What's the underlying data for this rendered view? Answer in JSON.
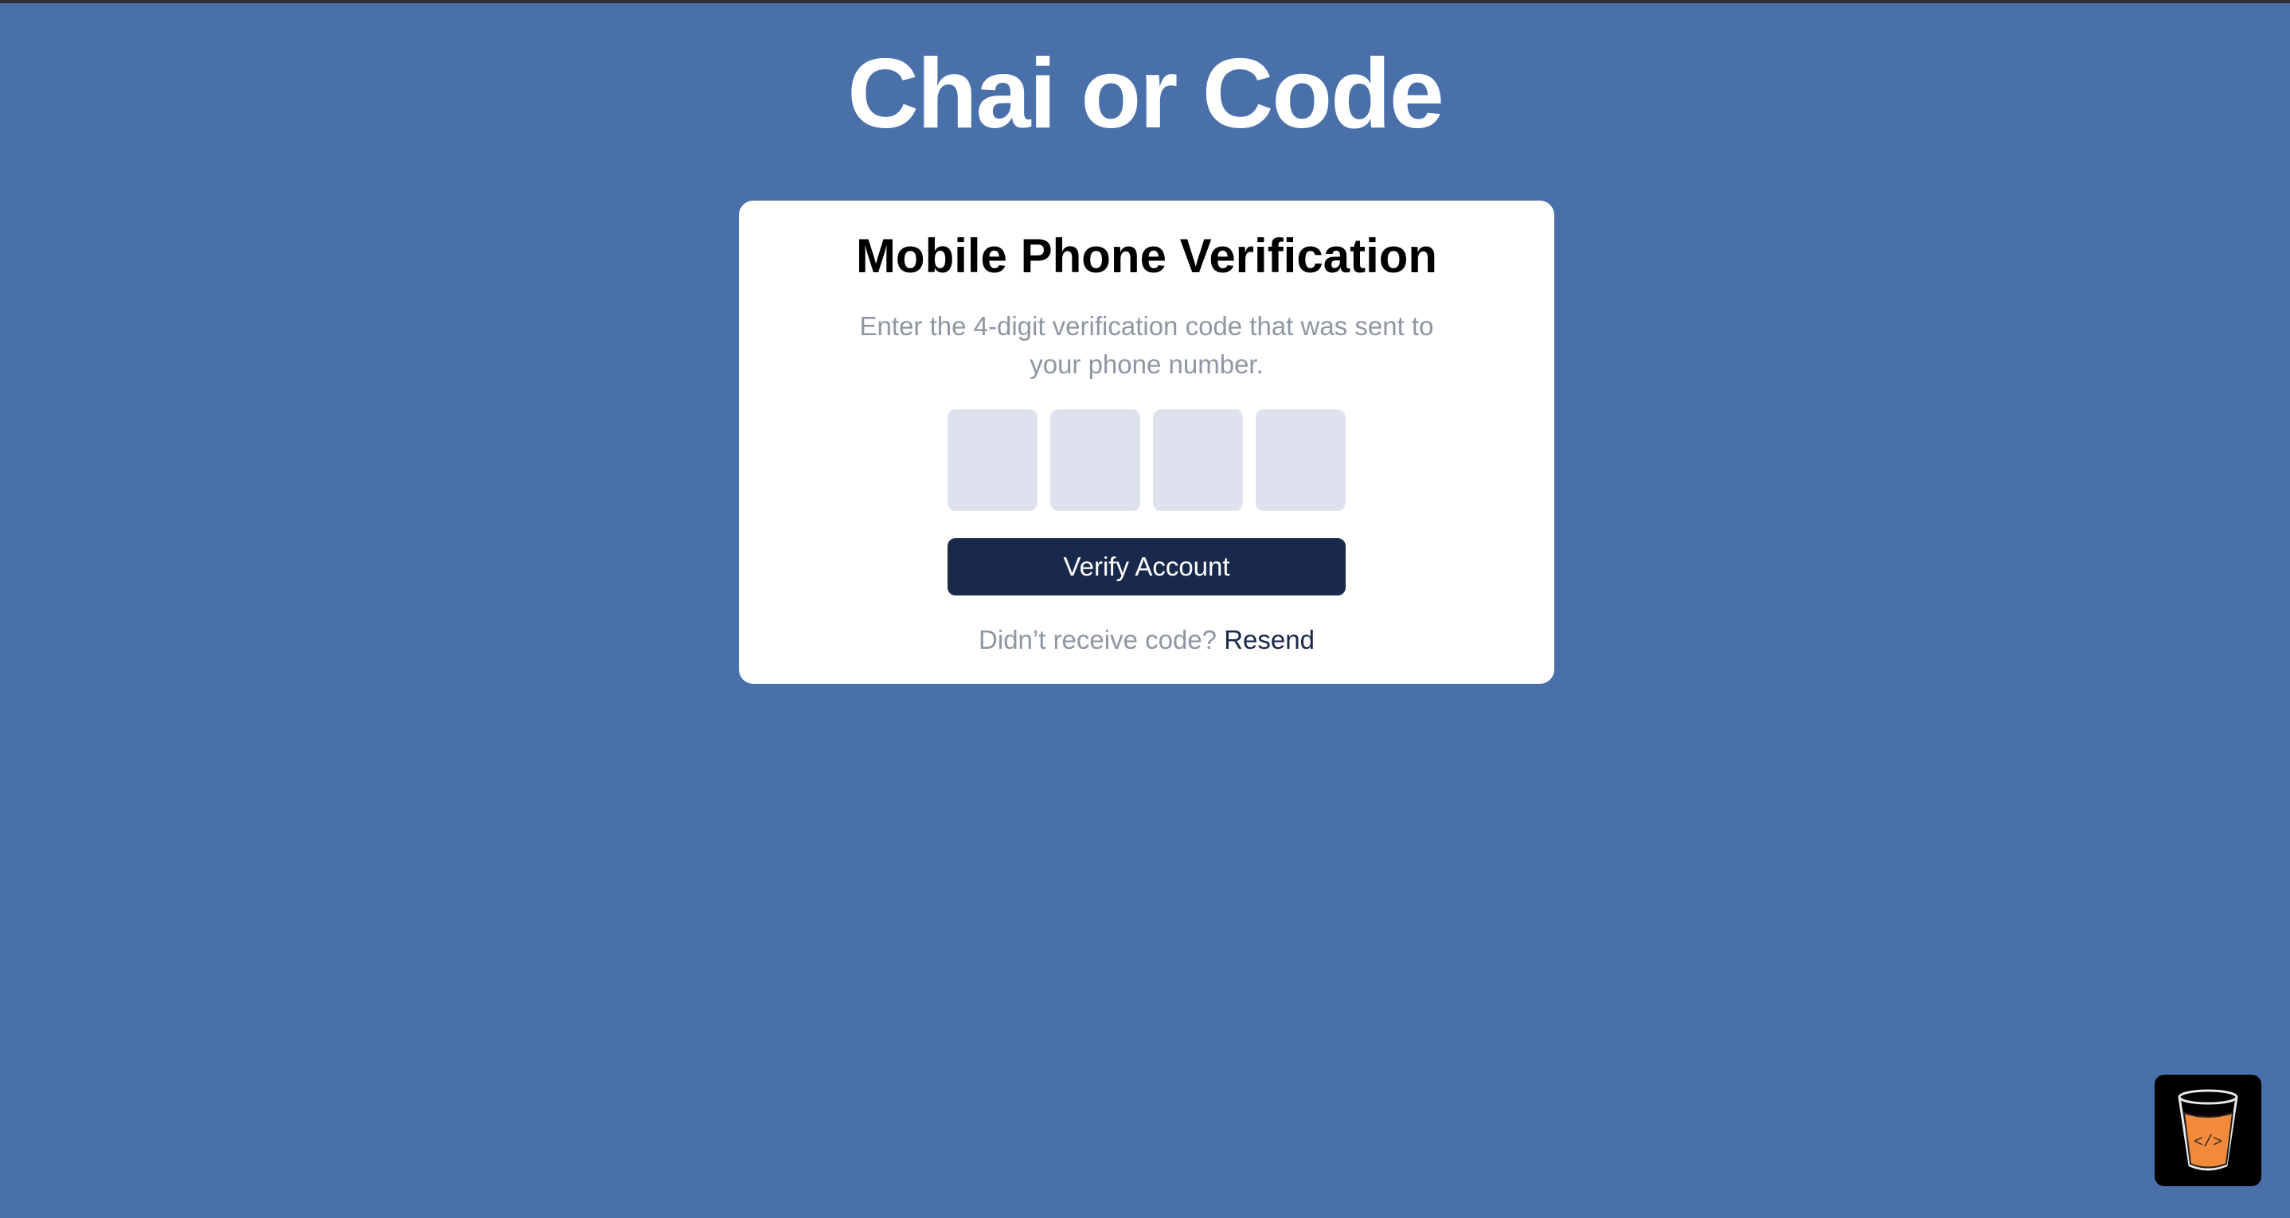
{
  "app": {
    "title": "Chai or Code"
  },
  "verification": {
    "title": "Mobile Phone Verification",
    "description": "Enter the 4-digit verification code that was sent to your phone number.",
    "code_digits": [
      "",
      "",
      "",
      ""
    ],
    "verify_button_label": "Verify Account",
    "resend_prompt": "Didn’t receive code?",
    "resend_link_label": "Resend"
  },
  "logo_badge": {
    "icon": "chai-cup-code-icon",
    "glyph": "</>"
  },
  "colors": {
    "background": "#4a70aa",
    "card": "#ffffff",
    "input_fill": "#dde2ee",
    "button": "#19294b",
    "muted_text": "#8f96a3",
    "cup_fill": "#f28a3c"
  }
}
